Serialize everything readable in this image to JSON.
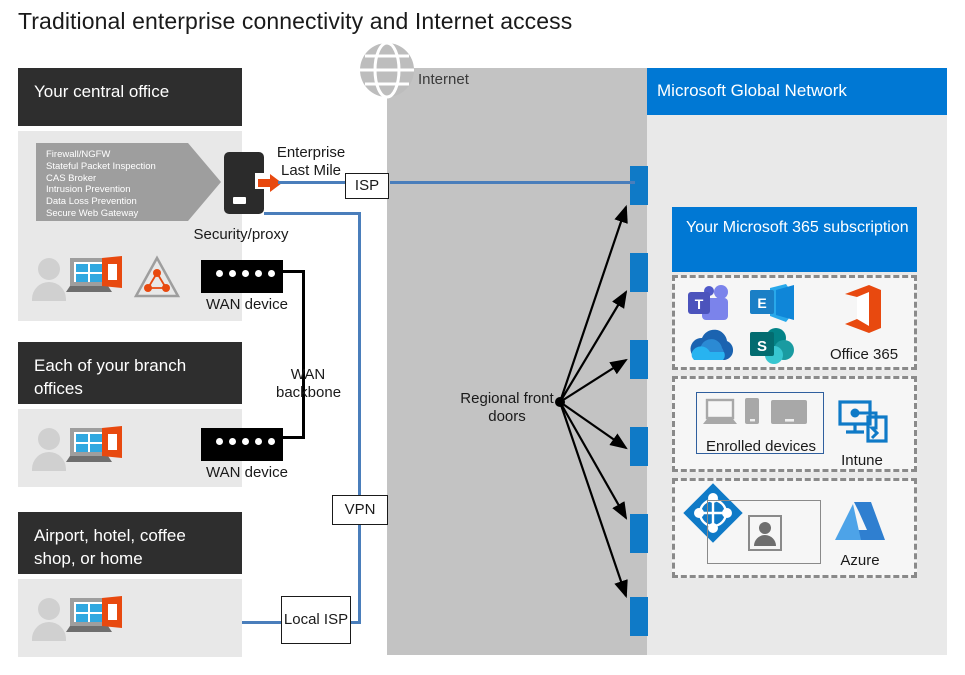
{
  "title": "Traditional enterprise connectivity and Internet access",
  "internet": {
    "label": "Internet",
    "globe_icon": "globe-icon"
  },
  "microsoft_global_network": {
    "header": "Microsoft Global Network"
  },
  "front_doors": {
    "label": "Regional front doors",
    "count": 6
  },
  "left_sections": [
    {
      "header": "Your central office",
      "callout_title": "security-stack-callout",
      "callout_items": [
        "Firewall/NGFW",
        "Stateful Packet Inspection",
        "CAS Broker",
        "Intrusion Prevention",
        "Data Loss Prevention",
        "Secure Web Gateway"
      ],
      "proxy_label": "Security/proxy",
      "wan_label": "WAN device",
      "user_icon": "person-laptop-office-icon",
      "warning_icon": "warning-network-icon"
    },
    {
      "header": "Each of your branch offices",
      "wan_label": "WAN device",
      "user_icon": "person-laptop-office-icon"
    },
    {
      "header": "Airport, hotel, coffee shop, or home",
      "user_icon": "person-laptop-office-icon"
    }
  ],
  "connectors": {
    "enterprise_last_mile": "Enterprise Last Mile",
    "isp": "ISP",
    "wan_backbone": "WAN backbone",
    "vpn": "VPN",
    "local_isp": "Local ISP"
  },
  "m365": {
    "header": "Your Microsoft 365 subscription",
    "office365": {
      "label": "Office 365",
      "icons": [
        "teams-icon",
        "exchange-icon",
        "onedrive-icon",
        "sharepoint-icon",
        "office-logo-icon"
      ]
    },
    "devices": {
      "label": "Enrolled devices",
      "icons": [
        "laptop-icon",
        "phone-icon",
        "tablet-icon"
      ],
      "service_label": "Intune",
      "service_icon": "intune-icon"
    },
    "identity": {
      "label": "Azure",
      "aad_icon": "azure-ad-icon",
      "user_icon": "user-account-icon",
      "service_icon": "azure-logo-icon"
    }
  },
  "colors": {
    "accent_blue": "#0078d4",
    "front_door_blue": "#0f7ac7",
    "line_blue": "#4a7ebb",
    "dark_header": "#2e2e2e",
    "internet_gray": "#c3c3c3",
    "panel_gray": "#e9e9e9",
    "orange": "#e8490f"
  }
}
